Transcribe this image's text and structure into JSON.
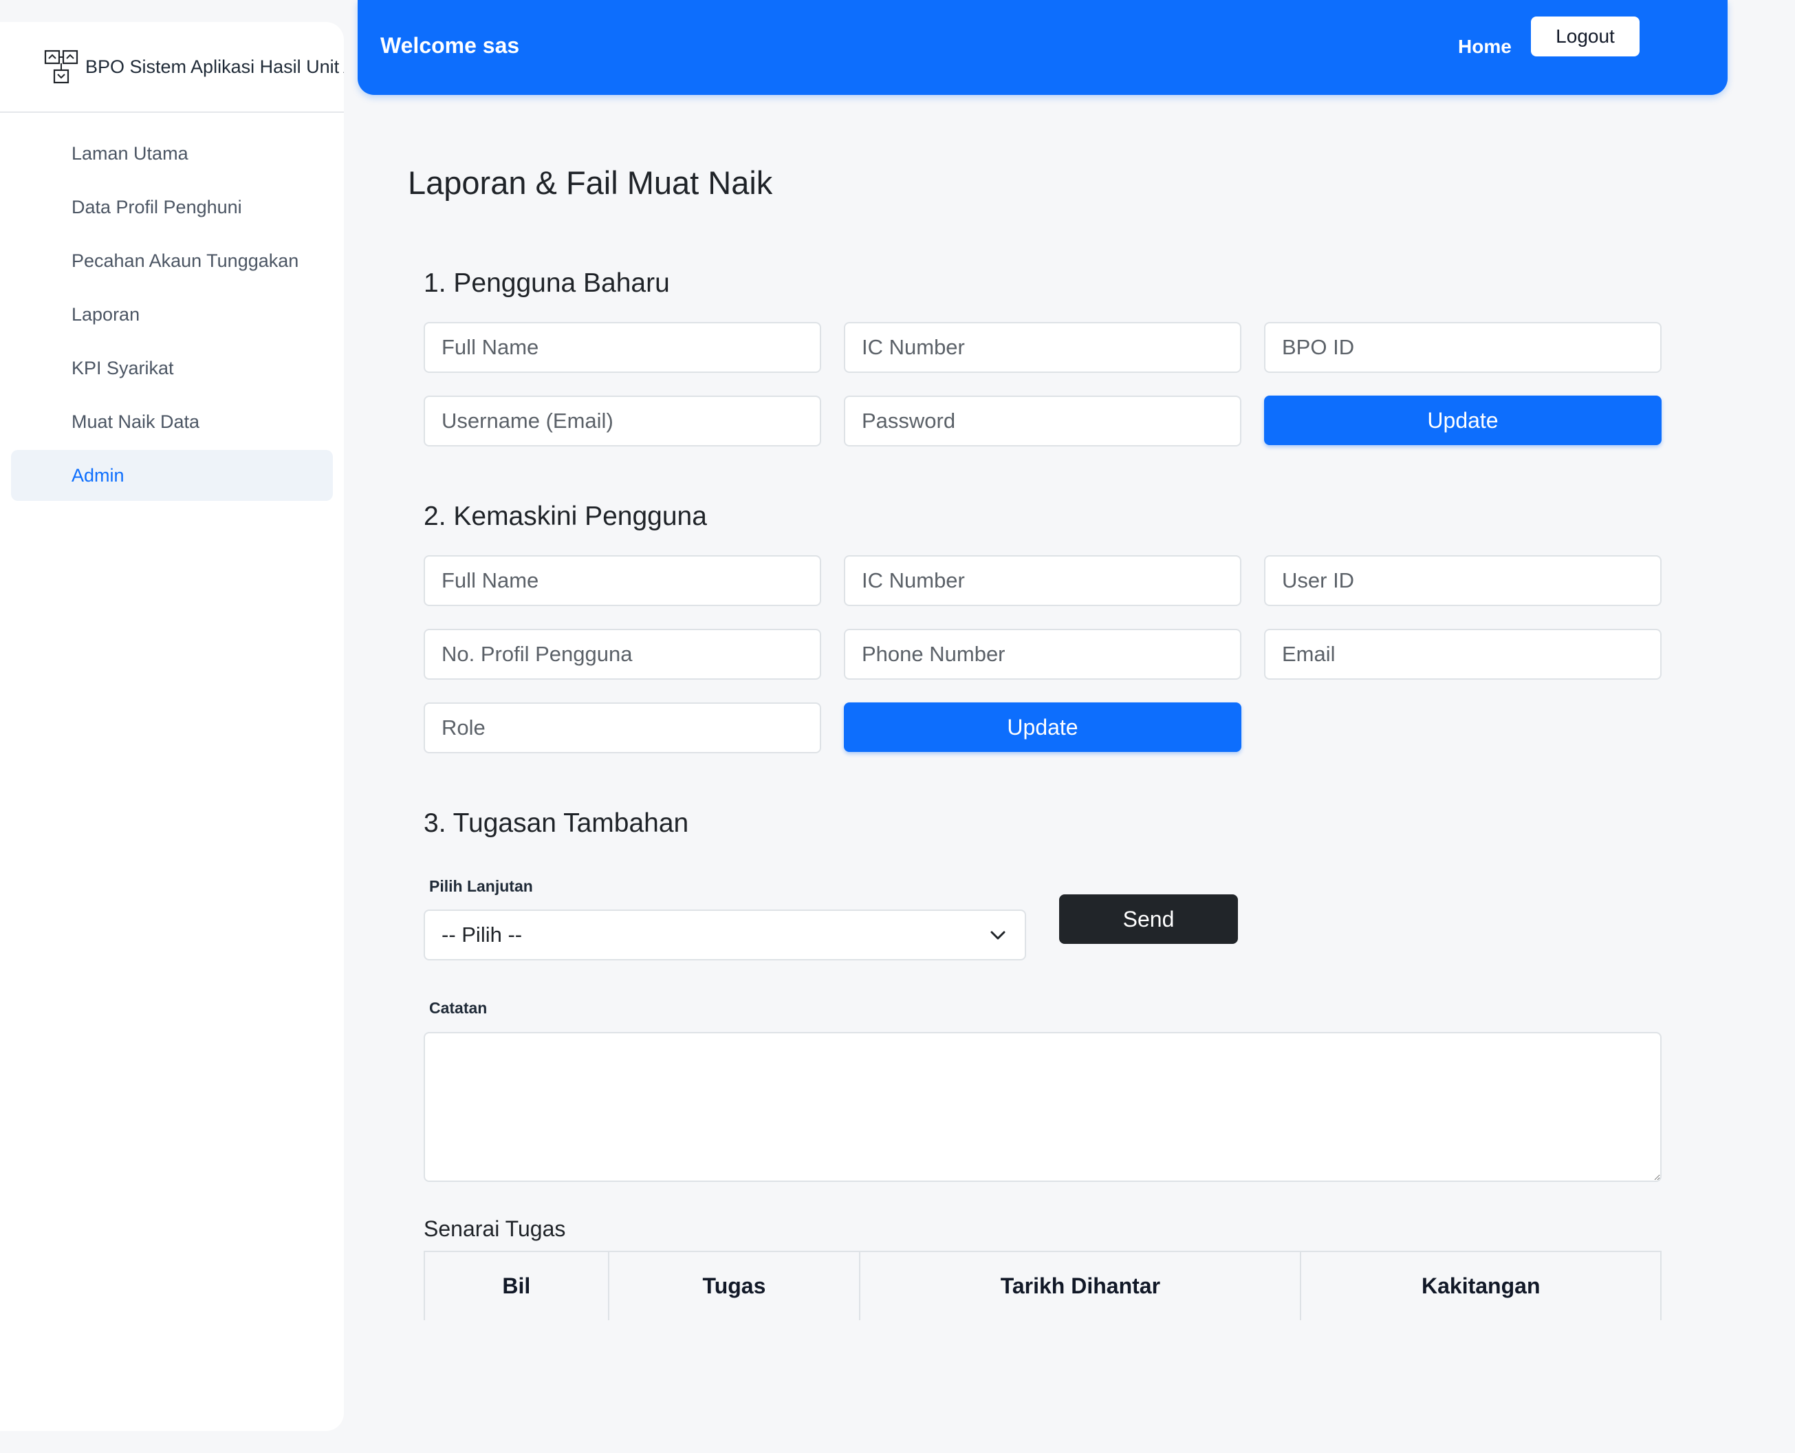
{
  "sidebar": {
    "brand": "BPO Sistem Aplikasi Hasil Unit A",
    "items": [
      {
        "label": "Laman Utama"
      },
      {
        "label": "Data Profil Penghuni"
      },
      {
        "label": "Pecahan Akaun Tunggakan"
      },
      {
        "label": "Laporan"
      },
      {
        "label": "KPI Syarikat"
      },
      {
        "label": "Muat Naik Data"
      },
      {
        "label": "Admin",
        "active": true
      }
    ]
  },
  "header": {
    "welcome": "Welcome sas",
    "home": "Home",
    "logout": "Logout",
    "color": "#0d6efd"
  },
  "main": {
    "title": "Laporan & Fail Muat Naik",
    "section1": {
      "title": "1. Pengguna Baharu",
      "placeholders": {
        "full_name": "Full Name",
        "ic_number": "IC Number",
        "bpo_id": "BPO ID",
        "username": "Username (Email)",
        "password": "Password"
      },
      "update": "Update"
    },
    "section2": {
      "title": "2. Kemaskini Pengguna",
      "placeholders": {
        "full_name": "Full Name",
        "ic_number": "IC Number",
        "user_id": "User ID",
        "profile_no": "No. Profil Pengguna",
        "phone": "Phone Number",
        "email": "Email",
        "role": "Role"
      },
      "update": "Update"
    },
    "section3": {
      "title": "3. Tugasan Tambahan",
      "select_label": "Pilih Lanjutan",
      "select_value": "-- Pilih --",
      "send": "Send",
      "notes_label": "Catatan",
      "table_caption": "Senarai Tugas",
      "columns": [
        "Bil",
        "Tugas",
        "Tarikh Dihantar",
        "Kakitangan"
      ]
    }
  }
}
